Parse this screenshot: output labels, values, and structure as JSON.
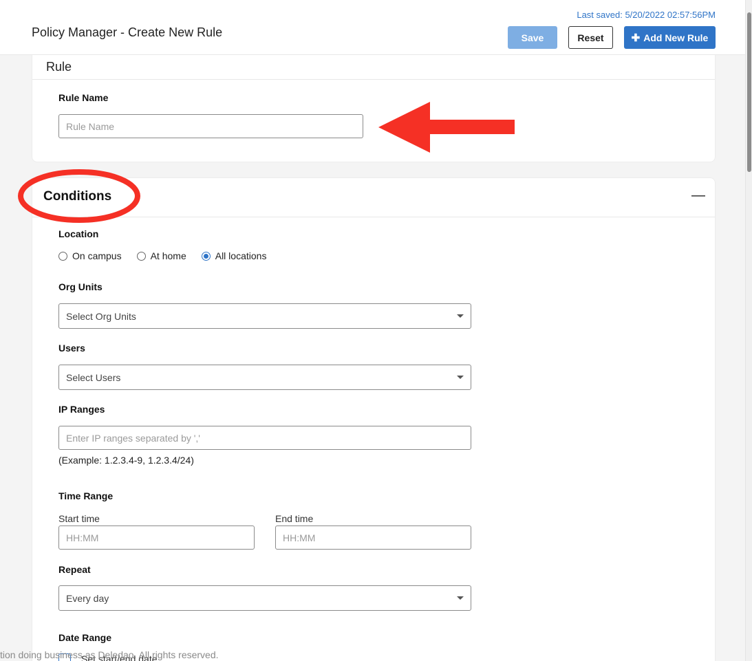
{
  "header": {
    "title": "Policy Manager - Create New Rule",
    "last_saved": "Last saved: 5/20/2022 02:57:56PM",
    "save_label": "Save",
    "reset_label": "Reset",
    "add_label": "Add New Rule",
    "add_icon": "plus-icon"
  },
  "rule_section": {
    "title": "Rule",
    "rule_name_label": "Rule Name",
    "rule_name_placeholder": "Rule Name"
  },
  "conditions": {
    "title": "Conditions",
    "collapse_icon": "minus-icon",
    "location_label": "Location",
    "location_options": [
      "On campus",
      "At home",
      "All locations"
    ],
    "location_selected": "All locations",
    "org_units_label": "Org Units",
    "org_units_value": "Select Org Units",
    "users_label": "Users",
    "users_value": "Select Users",
    "ip_ranges_label": "IP Ranges",
    "ip_ranges_placeholder": "Enter IP ranges separated by ','",
    "ip_ranges_hint": "(Example: 1.2.3.4-9, 1.2.3.4/24)",
    "time_range_label": "Time Range",
    "start_time_label": "Start time",
    "start_time_placeholder": "HH:MM",
    "end_time_label": "End time",
    "end_time_placeholder": "HH:MM",
    "repeat_label": "Repeat",
    "repeat_value": "Every day",
    "date_range_label": "Date Range",
    "date_range_checkbox": "Set start/end date"
  },
  "footer": {
    "copyright_fragment": "tion doing business as Deledao. All rights reserved."
  },
  "colors": {
    "accent": "#2f74c7",
    "save_disabled": "#7eaee3",
    "annotation": "#f53025"
  }
}
